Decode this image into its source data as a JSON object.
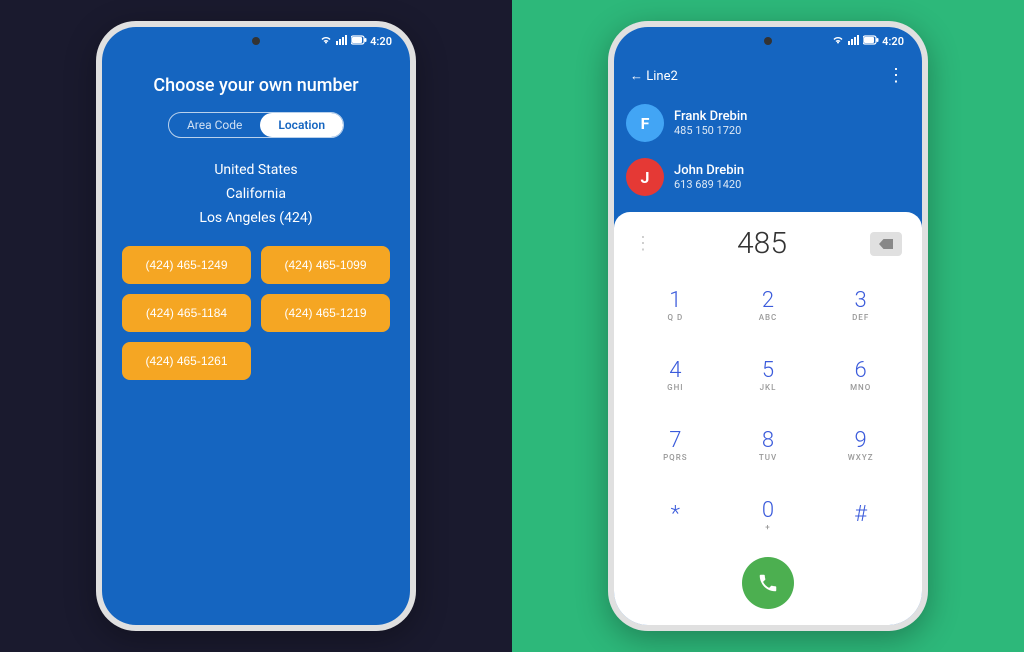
{
  "left_phone": {
    "status_bar": {
      "time": "4:20"
    },
    "screen": {
      "title": "Choose your own number",
      "tabs": [
        {
          "label": "Area Code",
          "active": false
        },
        {
          "label": "Location",
          "active": true
        }
      ],
      "location_items": [
        "United States",
        "California",
        "Los Angeles (424)"
      ],
      "phone_numbers": [
        "(424) 465-1249",
        "(424) 465-1099",
        "(424) 465-1184",
        "(424) 465-1219",
        "(424) 465-1261"
      ]
    }
  },
  "right_phone": {
    "status_bar": {
      "time": "4:20"
    },
    "header": {
      "back_label": "← Line2",
      "more_icon": "⋮"
    },
    "contacts": [
      {
        "initial": "F",
        "name": "Frank Drebin",
        "number": "485 150 1720",
        "avatar_color": "#42a5f5"
      },
      {
        "initial": "J",
        "name": "John Drebin",
        "number": "613 689 1420",
        "avatar_color": "#e53935"
      }
    ],
    "dialpad": {
      "current_input": "485",
      "keys": [
        {
          "number": "1",
          "letters": "Q D"
        },
        {
          "number": "2",
          "letters": "ABC"
        },
        {
          "number": "3",
          "letters": "DEF"
        },
        {
          "number": "4",
          "letters": "GHI"
        },
        {
          "number": "5",
          "letters": "JKL"
        },
        {
          "number": "6",
          "letters": "MNO"
        },
        {
          "number": "7",
          "letters": "PQRS"
        },
        {
          "number": "8",
          "letters": "TUV"
        },
        {
          "number": "9",
          "letters": "WXYZ"
        },
        {
          "number": "*",
          "letters": ""
        },
        {
          "number": "0",
          "letters": "+"
        },
        {
          "number": "#",
          "letters": ""
        }
      ]
    }
  },
  "colors": {
    "blue_bg": "#1565c0",
    "orange_btn": "#f5a623",
    "green_bg": "#2db87a",
    "dial_blue": "#3b5bdb",
    "call_green": "#4caf50"
  }
}
